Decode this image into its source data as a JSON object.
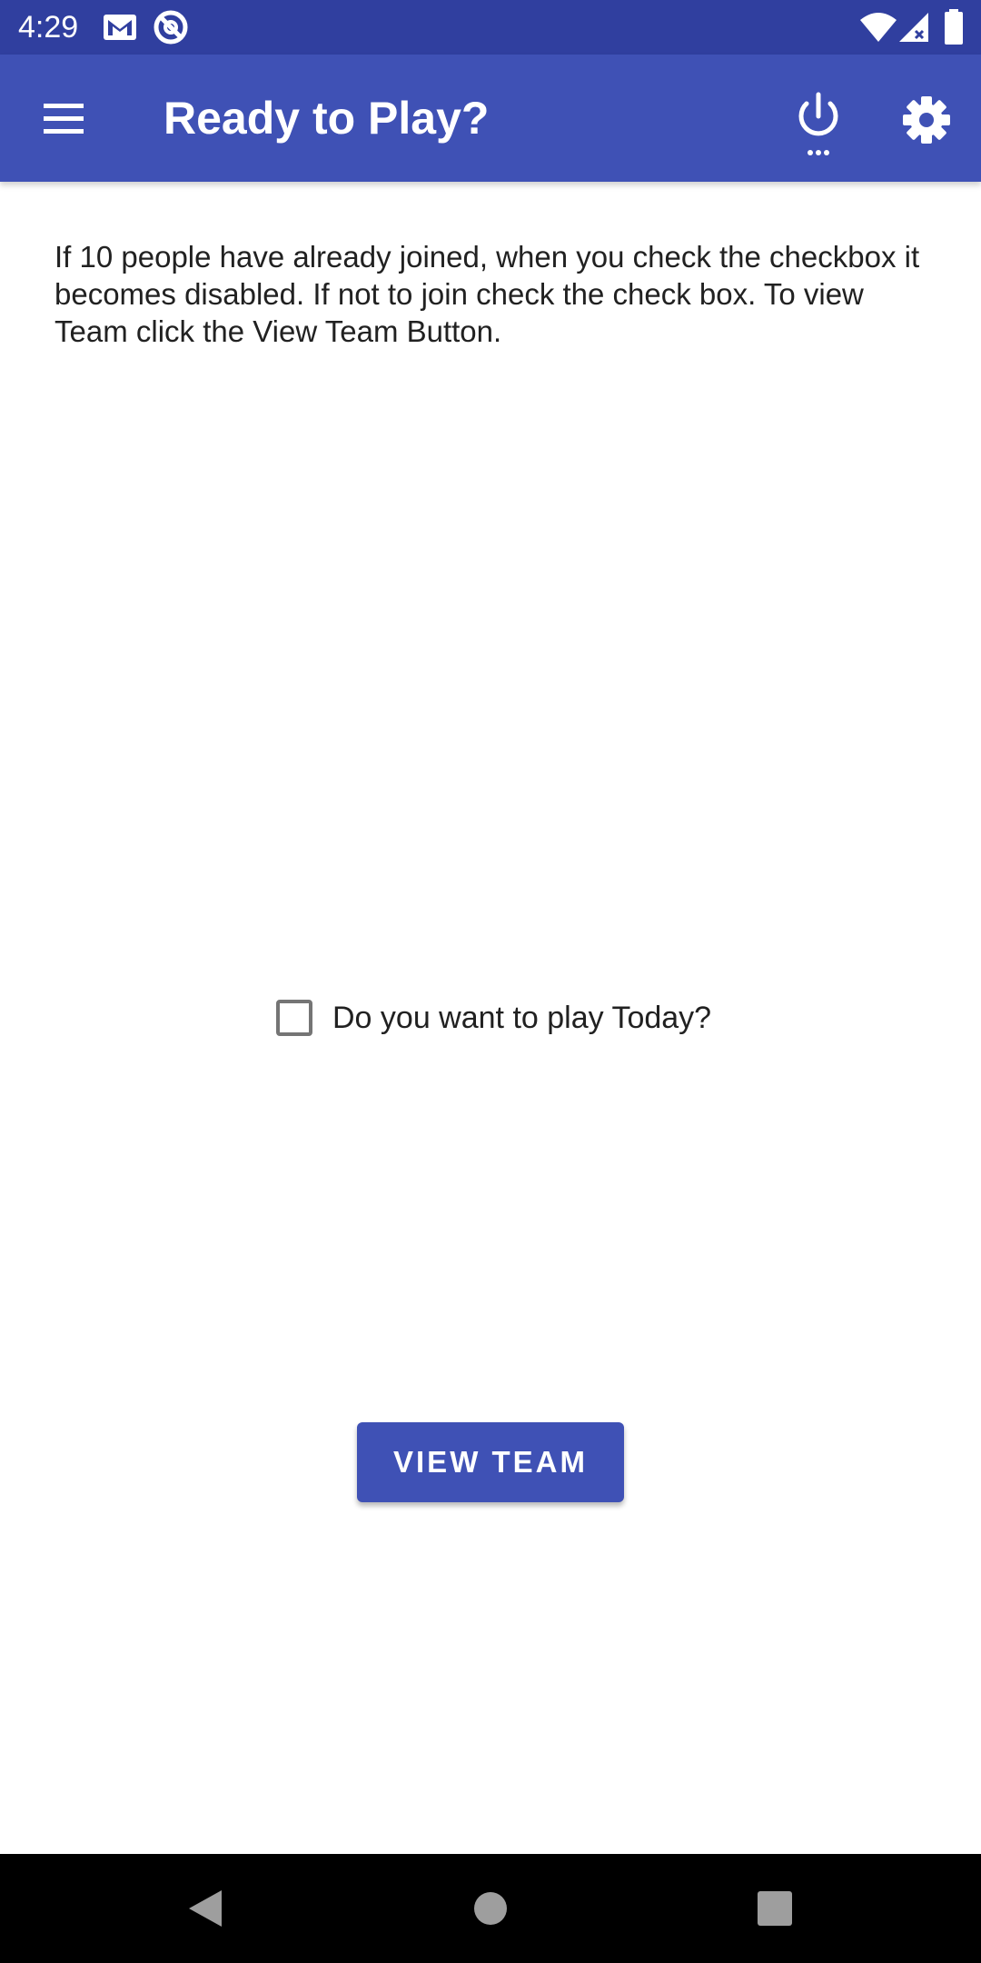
{
  "status_bar": {
    "time": "4:29",
    "left_icons": [
      "gmail-icon",
      "no-disturb-icon"
    ],
    "right_icons": [
      "wifi-icon",
      "signal-icon",
      "battery-icon"
    ]
  },
  "app_bar": {
    "title": "Ready to Play?",
    "menu_icon": "hamburger-menu-icon",
    "power_icon": "power-icon",
    "settings_icon": "gear-icon"
  },
  "content": {
    "instructions": "If 10 people have already joined, when you check the checkbox it becomes disabled. If not to join check the check box. To view Team click the View Team Button.",
    "checkbox_label": "Do you want to play Today?",
    "checkbox_checked": false,
    "view_team_label": "VIEW TEAM"
  },
  "nav_bar": {
    "icons": [
      "back-icon",
      "home-icon",
      "recents-icon"
    ]
  },
  "colors": {
    "status_bar": "#303f9f",
    "app_bar": "#3f51b5",
    "button": "#3f51b5",
    "nav_bar": "#000000"
  }
}
